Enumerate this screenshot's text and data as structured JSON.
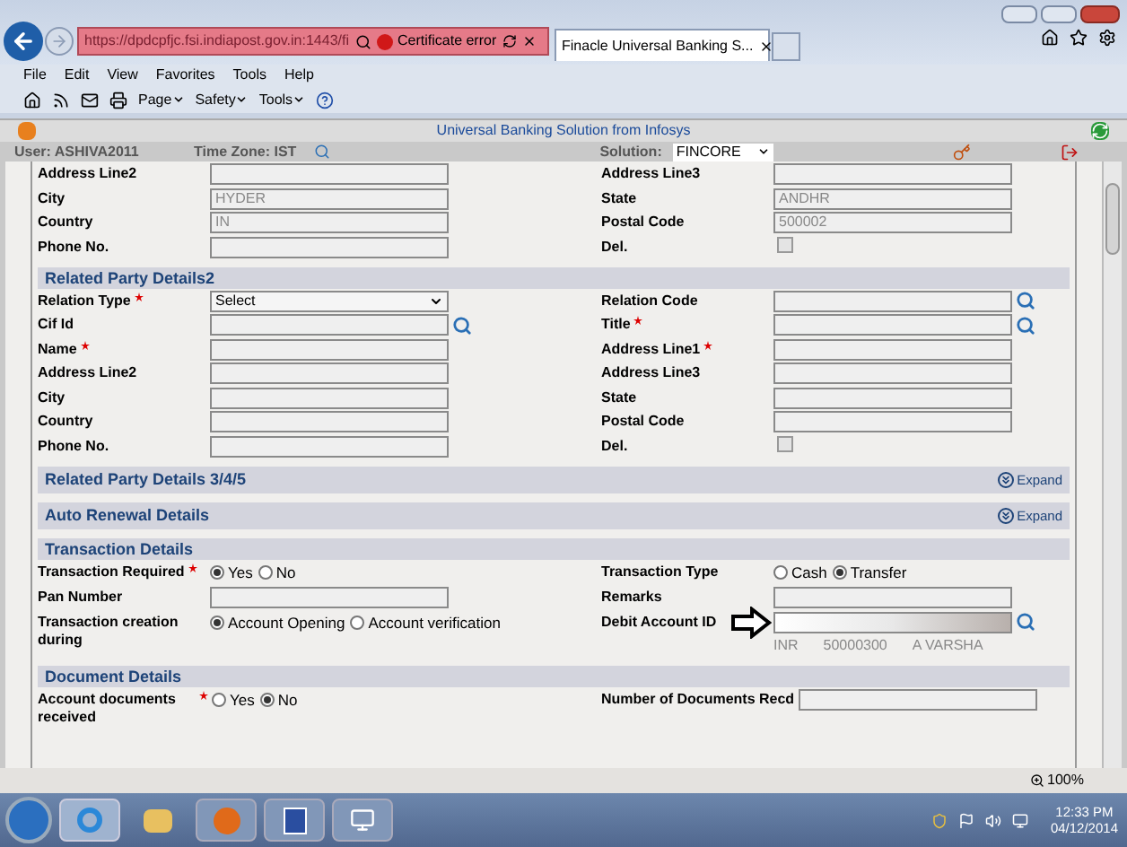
{
  "browser": {
    "url": "https://dpdcpfjc.fsi.indiapost.gov.in:1443/fi",
    "cert_error": "Certificate error",
    "tabs": [
      {
        "label": "Finacle Universal Banking S...",
        "selected": true
      }
    ],
    "menu": [
      "File",
      "Edit",
      "View",
      "Favorites",
      "Tools",
      "Help"
    ],
    "toolbar": [
      "Page",
      "Safety",
      "Tools"
    ]
  },
  "app": {
    "title": "Universal Banking Solution from Infosys",
    "user": "User: ASHIVA2011",
    "timezone": "Time Zone: IST",
    "solution_label": "Solution:",
    "solution": "FINCORE"
  },
  "sections": [
    {
      "rows": [
        {
          "left": {
            "label": "Address Line2",
            "field": {
              "kind": "text"
            }
          },
          "right": {
            "label": "Address Line3",
            "field": {
              "kind": "text"
            }
          }
        },
        {
          "left": {
            "label": "City",
            "field": {
              "kind": "text",
              "value": "HYDER"
            }
          },
          "right": {
            "label": "State",
            "field": {
              "kind": "text",
              "value": "ANDHR"
            }
          }
        },
        {
          "left": {
            "label": "Country",
            "field": {
              "kind": "text",
              "value": "IN"
            }
          },
          "right": {
            "label": "Postal Code",
            "field": {
              "kind": "text",
              "value": "500002"
            }
          }
        },
        {
          "left": {
            "label": "Phone No.",
            "field": {
              "kind": "text"
            }
          },
          "right": {
            "label": "Del.",
            "field": {
              "kind": "checkbox",
              "checked": false
            }
          }
        }
      ]
    },
    {
      "title": "Related Party Details2",
      "expanded": true,
      "rows": [
        {
          "left": {
            "label": "Relation Type",
            "required": true,
            "field": {
              "kind": "select",
              "value": "Select"
            }
          },
          "right": {
            "label": "Relation Code",
            "field": {
              "kind": "text",
              "lookup": true
            }
          }
        },
        {
          "left": {
            "label": "Cif Id",
            "field": {
              "kind": "text",
              "lookup": true
            }
          },
          "right": {
            "label": "Title",
            "required": true,
            "field": {
              "kind": "text",
              "lookup": true
            }
          }
        },
        {
          "left": {
            "label": "Name",
            "required": true,
            "field": {
              "kind": "text"
            }
          },
          "right": {
            "label": "Address Line1",
            "required": true,
            "field": {
              "kind": "text"
            }
          }
        },
        {
          "left": {
            "label": "Address Line2",
            "field": {
              "kind": "text"
            }
          },
          "right": {
            "label": "Address Line3",
            "field": {
              "kind": "text"
            }
          }
        },
        {
          "left": {
            "label": "City",
            "field": {
              "kind": "text"
            }
          },
          "right": {
            "label": "State",
            "field": {
              "kind": "text"
            }
          }
        },
        {
          "left": {
            "label": "Country",
            "field": {
              "kind": "text"
            }
          },
          "right": {
            "label": "Postal Code",
            "field": {
              "kind": "text"
            }
          }
        },
        {
          "left": {
            "label": "Phone No.",
            "field": {
              "kind": "text"
            }
          },
          "right": {
            "label": "Del.",
            "field": {
              "kind": "checkbox",
              "checked": false
            }
          }
        }
      ]
    },
    {
      "title": "Related Party Details 3/4/5",
      "expanded": false,
      "expand_label": "Expand"
    },
    {
      "title": "Auto Renewal Details",
      "expanded": false,
      "expand_label": "Expand"
    },
    {
      "title": "Transaction Details",
      "expanded": true,
      "rows": [
        {
          "left": {
            "label": "Transaction Required",
            "required": true,
            "field": {
              "kind": "radio",
              "options": [
                {
                  "label": "Yes",
                  "selected": true
                },
                {
                  "label": "No",
                  "selected": false
                }
              ]
            }
          },
          "right": {
            "label": "Transaction Type",
            "field": {
              "kind": "radio",
              "options": [
                {
                  "label": "Cash",
                  "selected": false
                },
                {
                  "label": "Transfer",
                  "selected": true
                }
              ]
            }
          }
        },
        {
          "left": {
            "label": "Pan Number",
            "field": {
              "kind": "text"
            }
          },
          "right": {
            "label": "Remarks",
            "field": {
              "kind": "text"
            }
          }
        },
        {
          "left": {
            "label": "Transaction creation during",
            "field": {
              "kind": "radio",
              "options": [
                {
                  "label": "Account Opening",
                  "selected": true
                },
                {
                  "label": "Account verification",
                  "selected": false
                }
              ]
            }
          },
          "right": {
            "label": "Debit Account ID",
            "field": {
              "kind": "account",
              "info": [
                "INR",
                "50000300",
                "A VARSHA"
              ]
            }
          }
        }
      ]
    },
    {
      "title": "Document Details",
      "expanded": true,
      "rows": [
        {
          "left": {
            "label": "Account documents received",
            "required": true,
            "field": {
              "kind": "radio",
              "options": [
                {
                  "label": "Yes",
                  "selected": false
                },
                {
                  "label": "No",
                  "selected": true
                }
              ]
            }
          },
          "right": {
            "label": "Number of Documents Recd",
            "field": {
              "kind": "text"
            }
          }
        }
      ]
    }
  ],
  "status": {
    "zoom": "100%"
  },
  "taskbar": {
    "time": "12:33 PM",
    "date": "04/12/2014"
  }
}
